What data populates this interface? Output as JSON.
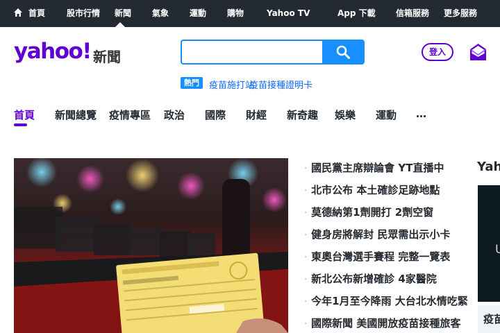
{
  "topnav": {
    "items": [
      {
        "label": "首頁"
      },
      {
        "label": "股市行情"
      },
      {
        "label": "新聞"
      },
      {
        "label": "氣象"
      },
      {
        "label": "運動"
      },
      {
        "label": "購物"
      },
      {
        "label": "Yahoo TV"
      },
      {
        "label": "App 下載"
      },
      {
        "label": "信箱服務"
      },
      {
        "label": "更多服務"
      }
    ],
    "active_index": 2
  },
  "header": {
    "logo_text": "yahoo!",
    "logo_sub": "新聞",
    "search": {
      "value": "",
      "placeholder": ""
    },
    "login_label": "登入",
    "brand_color": "#6001d2",
    "search_color": "#188fff"
  },
  "trending": {
    "tag": "熱門",
    "links": [
      "疫苗施打站",
      "疫苗接種證明卡"
    ]
  },
  "categories": [
    {
      "label": "首頁"
    },
    {
      "label": "新聞總覽"
    },
    {
      "label": "疫情專區"
    },
    {
      "label": "政治"
    },
    {
      "label": "國際"
    },
    {
      "label": "財經"
    },
    {
      "label": "新奇趣"
    },
    {
      "label": "娛樂"
    },
    {
      "label": "運動"
    },
    {
      "label": "…"
    }
  ],
  "headlines": [
    "國民黨主席辯論會 YT直播中",
    "北市公布 本土確診足跡地點",
    "莫德納第1劑開打 2劑空窗",
    "健身房將解封 民眾需出示小卡",
    "東奧台灣選手賽程 完整一覽表",
    "新北公布新增確診 4家醫院",
    "今年1月至今降雨 大台北水情吃緊",
    "國際新聞 美國開放疫苗接種旅客"
  ],
  "right_column": {
    "title": "Yahoo",
    "video_letter": "U",
    "caption": "疫苗"
  }
}
